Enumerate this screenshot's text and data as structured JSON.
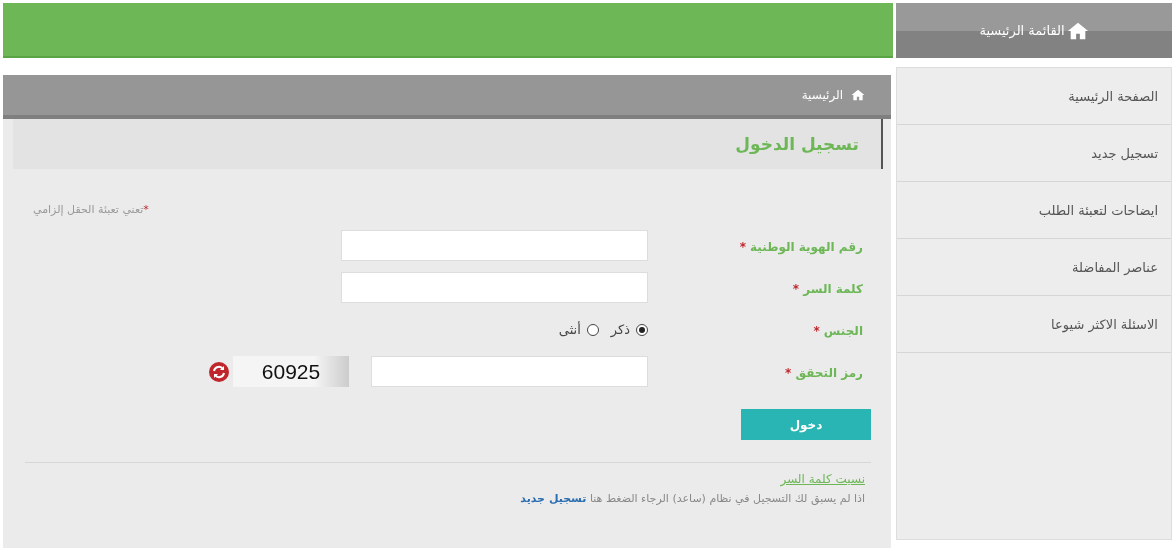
{
  "header": {
    "menu_title": "القائمة الرئيسية"
  },
  "breadcrumb": "الرئيسية",
  "page_title": "تسجيل الدخول",
  "required_note": {
    "mark": "*",
    "text": "تعني تعبئة الحقل إلزامي"
  },
  "fields": [
    {
      "kind": "text",
      "label": "رقم الهوية الوطنية",
      "mark": "*"
    },
    {
      "kind": "password",
      "label": "كلمة السر",
      "mark": "*"
    },
    {
      "kind": "radio",
      "label": "الجنس",
      "mark": "*",
      "options": [
        {
          "label": "ذكر",
          "selected": true
        },
        {
          "label": "أنثى",
          "selected": false
        }
      ]
    },
    {
      "kind": "captcha",
      "label": "رمز التحقق",
      "mark": "*",
      "code": "60925"
    }
  ],
  "submit": "دخول",
  "forgot_link": "نسيت كلمة السر",
  "register": {
    "text": "اذا لم يسبق لك التسجيل في نظام (ساعد) الرجاء الضغط هنا",
    "link": "تسجيل جديد"
  },
  "sidebar": {
    "items": [
      "الصفحة الرئيسية",
      "تسجيل جديد",
      "ايضاحات لتعبئة الطلب",
      "عناصر المفاضلة",
      "الاسئلة الاكثر شيوعا"
    ]
  }
}
